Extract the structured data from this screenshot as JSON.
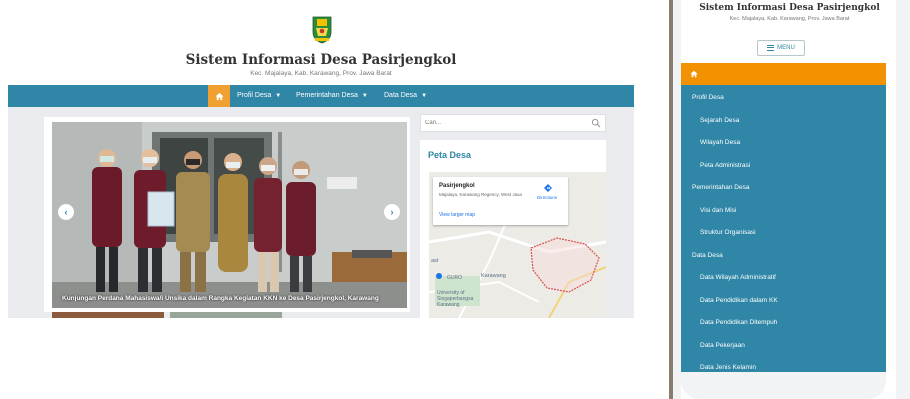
{
  "site": {
    "title": "Sistem Informasi Desa Pasirjengkol",
    "subtitle": "Kec. Majalaya, Kab. Karawang, Prov. Jawa Barat"
  },
  "navbar": {
    "home_icon": "home-icon",
    "items": [
      {
        "label": "Profil Desa"
      },
      {
        "label": "Pemerintahan Desa"
      },
      {
        "label": "Data Desa"
      }
    ],
    "colors": {
      "bar": "#2f86a6",
      "home": "#f0a030"
    }
  },
  "slider": {
    "caption": "Kunjungan Perdana Mahasiswa/i Unsika dalam Rangka Kegiatan KKN ke Desa Pasirjengkol, Karawang",
    "prev_icon": "chevron-left-icon",
    "next_icon": "chevron-right-icon"
  },
  "search": {
    "placeholder": "Cari..."
  },
  "map_widget": {
    "title": "Peta Desa",
    "place_name": "Pasirjengkol",
    "address": "Majalaya, Karawang Regency, West Java",
    "directions_label": "Directions",
    "larger_map_label": "View larger map",
    "labels": {
      "karawang": "Karawang",
      "university": "University of Singaperbangsa Karawang",
      "east": "ast",
      "guro": "GURO"
    }
  },
  "mobile": {
    "title": "Sistem Informasi Desa Pasirjengkol",
    "subtitle": "Kec. Majalaya, Kab. Karawang, Prov. Jawa Barat",
    "menu_label": "MENU",
    "home_icon": "home-icon",
    "menu_items": [
      {
        "label": "Profil Desa",
        "level": "top"
      },
      {
        "label": "Sejarah Desa",
        "level": "sub"
      },
      {
        "label": "Wilayah Desa",
        "level": "sub"
      },
      {
        "label": "Peta Administrasi",
        "level": "sub"
      },
      {
        "label": "Pemerintahan Desa",
        "level": "top"
      },
      {
        "label": "Visi dan Misi",
        "level": "sub"
      },
      {
        "label": "Struktur Organisasi",
        "level": "sub"
      },
      {
        "label": "Data Desa",
        "level": "top"
      },
      {
        "label": "Data Wilayah Administratif",
        "level": "sub"
      },
      {
        "label": "Data Pendidikan dalam KK",
        "level": "sub"
      },
      {
        "label": "Data Pendidikan Ditempuh",
        "level": "sub"
      },
      {
        "label": "Data Pekerjaan",
        "level": "sub"
      },
      {
        "label": "Data Jenis Kelamin",
        "level": "sub"
      }
    ],
    "colors": {
      "nav": "#2f86a6",
      "home": "#f39200"
    }
  }
}
